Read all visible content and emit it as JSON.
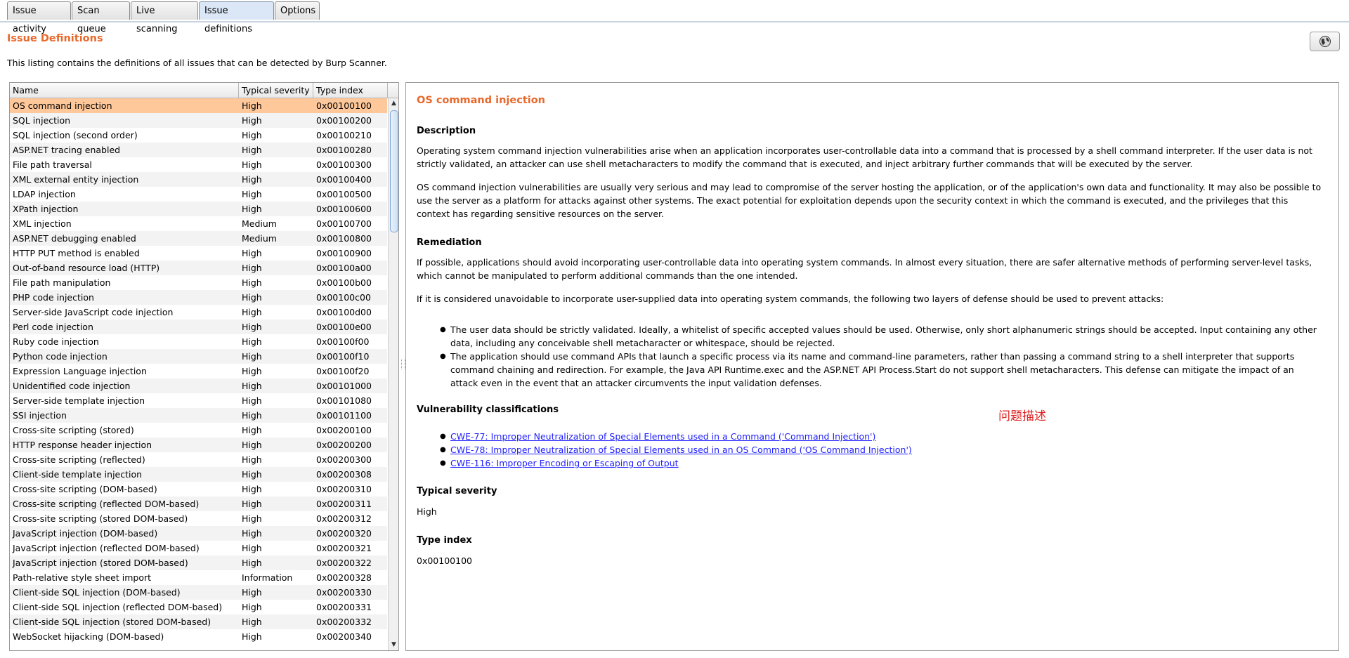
{
  "tabs": [
    {
      "label": "Issue activity"
    },
    {
      "label": "Scan queue"
    },
    {
      "label": "Live scanning"
    },
    {
      "label": "Issue definitions",
      "active": true
    },
    {
      "label": "Options"
    }
  ],
  "page": {
    "title": "Issue Definitions",
    "description": "This listing contains the definitions of all issues that can be detected by Burp Scanner."
  },
  "table": {
    "columns": [
      "Name",
      "Typical severity",
      "Type index"
    ],
    "rows": [
      {
        "name": "OS command injection",
        "severity": "High",
        "index": "0x00100100"
      },
      {
        "name": "SQL injection",
        "severity": "High",
        "index": "0x00100200"
      },
      {
        "name": "SQL injection (second order)",
        "severity": "High",
        "index": "0x00100210"
      },
      {
        "name": "ASP.NET tracing enabled",
        "severity": "High",
        "index": "0x00100280"
      },
      {
        "name": "File path traversal",
        "severity": "High",
        "index": "0x00100300"
      },
      {
        "name": "XML external entity injection",
        "severity": "High",
        "index": "0x00100400"
      },
      {
        "name": "LDAP injection",
        "severity": "High",
        "index": "0x00100500"
      },
      {
        "name": "XPath injection",
        "severity": "High",
        "index": "0x00100600"
      },
      {
        "name": "XML injection",
        "severity": "Medium",
        "index": "0x00100700"
      },
      {
        "name": "ASP.NET debugging enabled",
        "severity": "Medium",
        "index": "0x00100800"
      },
      {
        "name": "HTTP PUT method is enabled",
        "severity": "High",
        "index": "0x00100900"
      },
      {
        "name": "Out-of-band resource load (HTTP)",
        "severity": "High",
        "index": "0x00100a00"
      },
      {
        "name": "File path manipulation",
        "severity": "High",
        "index": "0x00100b00"
      },
      {
        "name": "PHP code injection",
        "severity": "High",
        "index": "0x00100c00"
      },
      {
        "name": "Server-side JavaScript code injection",
        "severity": "High",
        "index": "0x00100d00"
      },
      {
        "name": "Perl code injection",
        "severity": "High",
        "index": "0x00100e00"
      },
      {
        "name": "Ruby code injection",
        "severity": "High",
        "index": "0x00100f00"
      },
      {
        "name": "Python code injection",
        "severity": "High",
        "index": "0x00100f10"
      },
      {
        "name": "Expression Language injection",
        "severity": "High",
        "index": "0x00100f20"
      },
      {
        "name": "Unidentified code injection",
        "severity": "High",
        "index": "0x00101000"
      },
      {
        "name": "Server-side template injection",
        "severity": "High",
        "index": "0x00101080"
      },
      {
        "name": "SSI injection",
        "severity": "High",
        "index": "0x00101100"
      },
      {
        "name": "Cross-site scripting (stored)",
        "severity": "High",
        "index": "0x00200100"
      },
      {
        "name": "HTTP response header injection",
        "severity": "High",
        "index": "0x00200200"
      },
      {
        "name": "Cross-site scripting (reflected)",
        "severity": "High",
        "index": "0x00200300"
      },
      {
        "name": "Client-side template injection",
        "severity": "High",
        "index": "0x00200308"
      },
      {
        "name": "Cross-site scripting (DOM-based)",
        "severity": "High",
        "index": "0x00200310"
      },
      {
        "name": "Cross-site scripting (reflected DOM-based)",
        "severity": "High",
        "index": "0x00200311"
      },
      {
        "name": "Cross-site scripting (stored DOM-based)",
        "severity": "High",
        "index": "0x00200312"
      },
      {
        "name": "JavaScript injection (DOM-based)",
        "severity": "High",
        "index": "0x00200320"
      },
      {
        "name": "JavaScript injection (reflected DOM-based)",
        "severity": "High",
        "index": "0x00200321"
      },
      {
        "name": "JavaScript injection (stored DOM-based)",
        "severity": "High",
        "index": "0x00200322"
      },
      {
        "name": "Path-relative style sheet import",
        "severity": "Information",
        "index": "0x00200328"
      },
      {
        "name": "Client-side SQL injection (DOM-based)",
        "severity": "High",
        "index": "0x00200330"
      },
      {
        "name": "Client-side SQL injection (reflected DOM-based)",
        "severity": "High",
        "index": "0x00200331"
      },
      {
        "name": "Client-side SQL injection (stored DOM-based)",
        "severity": "High",
        "index": "0x00200332"
      },
      {
        "name": "WebSocket hijacking (DOM-based)",
        "severity": "High",
        "index": "0x00200340"
      }
    ]
  },
  "detail": {
    "title": "OS command injection",
    "description_heading": "Description",
    "description_p1": "Operating system command injection vulnerabilities arise when an application incorporates user-controllable data into a command that is processed by a shell command interpreter. If the user data is not strictly validated, an attacker can use shell metacharacters to modify the command that is executed, and inject arbitrary further commands that will be executed by the server.",
    "description_p2": "OS command injection vulnerabilities are usually very serious and may lead to compromise of the server hosting the application, or of the application's own data and functionality. It may also be possible to use the server as a platform for attacks against other systems. The exact potential for exploitation depends upon the security context in which the command is executed, and the privileges that this context has regarding sensitive resources on the server.",
    "remediation_heading": "Remediation",
    "remediation_p1": "If possible, applications should avoid incorporating user-controllable data into operating system commands. In almost every situation, there are safer alternative methods of performing server-level tasks, which cannot be manipulated to perform additional commands than the one intended.",
    "remediation_p2": "If it is considered unavoidable to incorporate user-supplied data into operating system commands, the following two layers of defense should be used to prevent attacks:",
    "remediation_bullets": [
      "The user data should be strictly validated. Ideally, a whitelist of specific accepted values should be used. Otherwise, only short alphanumeric strings should be accepted. Input containing any other data, including any conceivable shell metacharacter or whitespace, should be rejected.",
      "The application should use command APIs that launch a specific process via its name and command-line parameters, rather than passing a command string to a shell interpreter that supports command chaining and redirection. For example, the Java API Runtime.exec and the ASP.NET API Process.Start do not support shell metacharacters. This defense can mitigate the impact of an attack even in the event that an attacker circumvents the input validation defenses."
    ],
    "classifications_heading": "Vulnerability classifications",
    "classifications": [
      "CWE-77: Improper Neutralization of Special Elements used in a Command ('Command Injection')",
      "CWE-78: Improper Neutralization of Special Elements used in an OS Command ('OS Command Injection')",
      "CWE-116: Improper Encoding or Escaping of Output"
    ],
    "severity_heading": "Typical severity",
    "severity_value": "High",
    "type_index_heading": "Type index",
    "type_index_value": "0x00100100",
    "overlay_annotation": "问题描述"
  },
  "icons": {
    "globe_button": "globe-icon",
    "scroll_up": "arrow-up-icon",
    "scroll_down": "arrow-down-icon"
  },
  "colors": {
    "accent": "#e8692c",
    "selected_row": "#ffc89a",
    "link": "#2020ff",
    "annotation": "#e02020"
  }
}
